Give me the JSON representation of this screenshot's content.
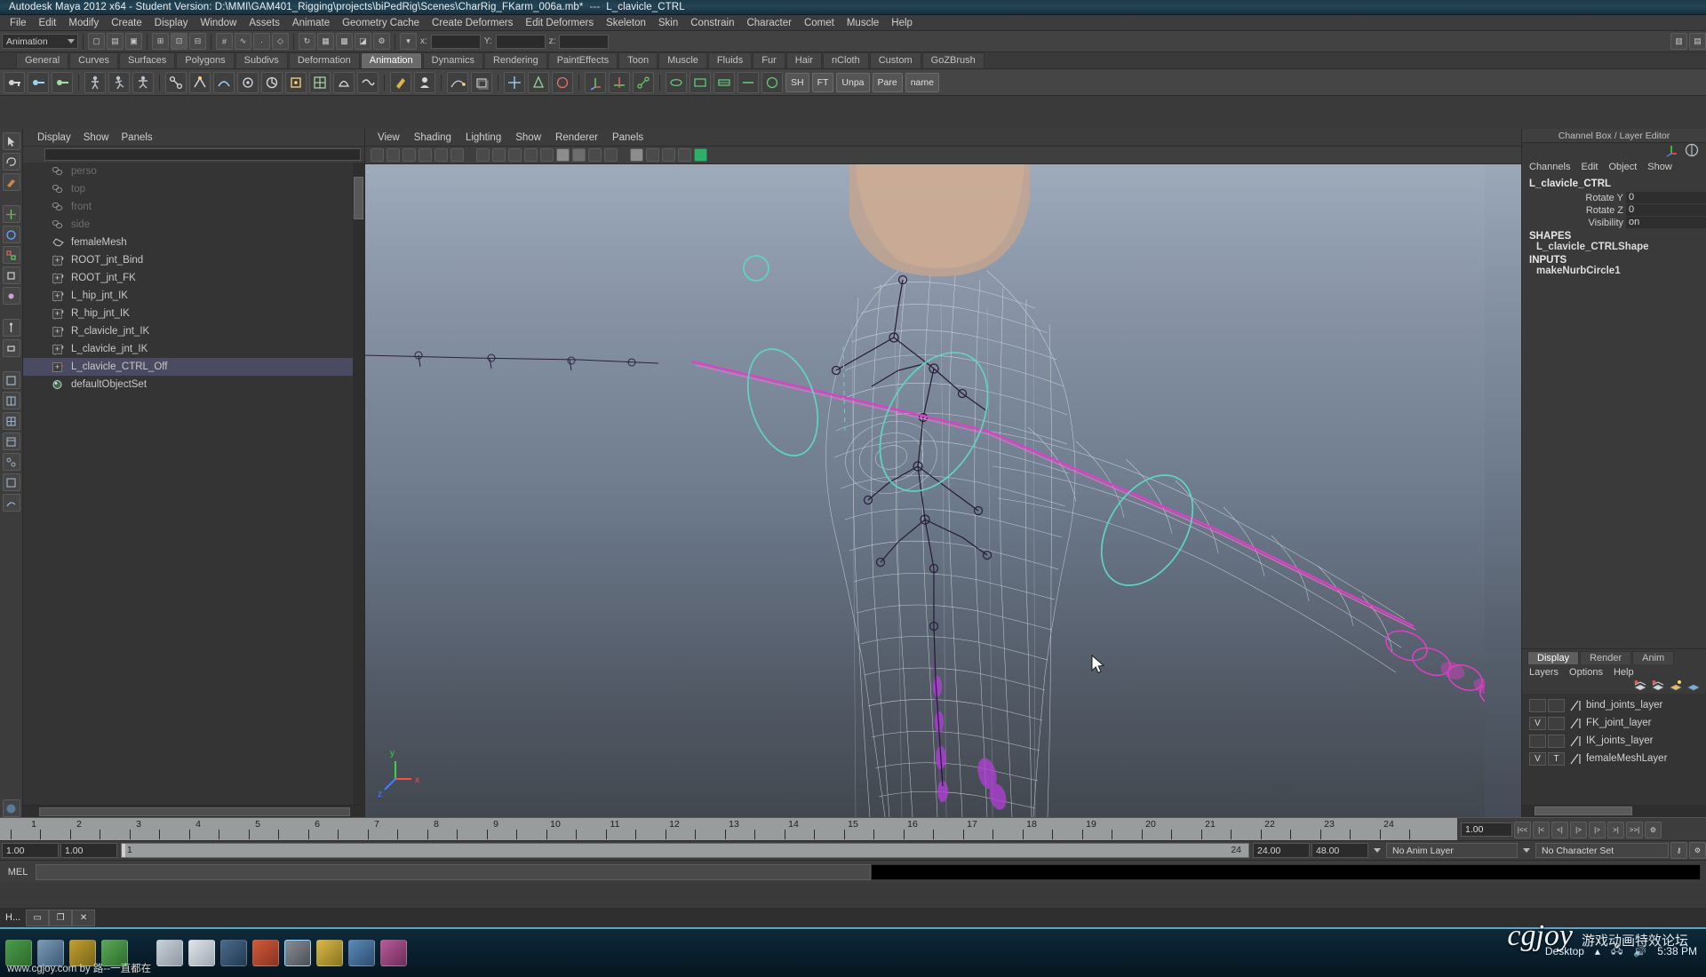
{
  "titlebar": {
    "app": "Autodesk Maya 2012 x64 - Student Version: D:\\MMI\\GAM401_Rigging\\projects\\biPedRig\\Scenes\\CharRig_FKarm_006a.mb*",
    "separator": "---",
    "selection": "L_clavicle_CTRL"
  },
  "menubar": {
    "items": [
      {
        "label": "File"
      },
      {
        "label": "Edit"
      },
      {
        "label": "Modify"
      },
      {
        "label": "Create"
      },
      {
        "label": "Display"
      },
      {
        "label": "Window"
      },
      {
        "label": "Assets"
      },
      {
        "label": "Animate"
      },
      {
        "label": "Geometry Cache"
      },
      {
        "label": "Create Deformers"
      },
      {
        "label": "Edit Deformers"
      },
      {
        "label": "Skeleton"
      },
      {
        "label": "Skin"
      },
      {
        "label": "Constrain"
      },
      {
        "label": "Character"
      },
      {
        "label": "Comet"
      },
      {
        "label": "Muscle"
      },
      {
        "label": "Help"
      }
    ]
  },
  "statusline": {
    "mode_selector": "Animation",
    "axis_labels": [
      "x:",
      "Y:",
      "z:"
    ],
    "axis_values": [
      "",
      "",
      ""
    ]
  },
  "shelf": {
    "tabs": [
      {
        "label": "General",
        "active": false
      },
      {
        "label": "Curves",
        "active": false
      },
      {
        "label": "Surfaces",
        "active": false
      },
      {
        "label": "Polygons",
        "active": false
      },
      {
        "label": "Subdivs",
        "active": false
      },
      {
        "label": "Deformation",
        "active": false
      },
      {
        "label": "Animation",
        "active": true
      },
      {
        "label": "Dynamics",
        "active": false
      },
      {
        "label": "Rendering",
        "active": false
      },
      {
        "label": "PaintEffects",
        "active": false
      },
      {
        "label": "Toon",
        "active": false
      },
      {
        "label": "Muscle",
        "active": false
      },
      {
        "label": "Fluids",
        "active": false
      },
      {
        "label": "Fur",
        "active": false
      },
      {
        "label": "Hair",
        "active": false
      },
      {
        "label": "nCloth",
        "active": false
      },
      {
        "label": "Custom",
        "active": false
      },
      {
        "label": "GoZBrush",
        "active": false
      }
    ],
    "text_buttons": [
      {
        "label": "SH"
      },
      {
        "label": "FT"
      },
      {
        "label": "Unpa"
      },
      {
        "label": "Pare"
      },
      {
        "label": "name"
      }
    ]
  },
  "outliner": {
    "menu": [
      "Display",
      "Show",
      "Panels"
    ],
    "search_value": "",
    "items": [
      {
        "label": "perso",
        "icon": "camera-icon",
        "dim": true,
        "expandable": false,
        "selected": false
      },
      {
        "label": "top",
        "icon": "camera-icon",
        "dim": true,
        "expandable": false,
        "selected": false
      },
      {
        "label": "front",
        "icon": "camera-icon",
        "dim": true,
        "expandable": false,
        "selected": false
      },
      {
        "label": "side",
        "icon": "camera-icon",
        "dim": true,
        "expandable": false,
        "selected": false
      },
      {
        "label": "femaleMesh",
        "icon": "mesh-icon",
        "dim": false,
        "expandable": false,
        "selected": false
      },
      {
        "label": "ROOT_jnt_Bind",
        "icon": "joint-icon",
        "dim": false,
        "expandable": true,
        "selected": false
      },
      {
        "label": "ROOT_jnt_FK",
        "icon": "joint-icon",
        "dim": false,
        "expandable": true,
        "selected": false
      },
      {
        "label": "L_hip_jnt_IK",
        "icon": "joint-icon",
        "dim": false,
        "expandable": true,
        "selected": false
      },
      {
        "label": "R_hip_jnt_IK",
        "icon": "joint-icon",
        "dim": false,
        "expandable": true,
        "selected": false
      },
      {
        "label": "R_clavicle_jnt_IK",
        "icon": "joint-icon",
        "dim": false,
        "expandable": true,
        "selected": false
      },
      {
        "label": "L_clavicle_jnt_IK",
        "icon": "joint-icon",
        "dim": false,
        "expandable": true,
        "selected": false
      },
      {
        "label": "L_clavicle_CTRL_Off",
        "icon": "curve-icon",
        "dim": false,
        "expandable": true,
        "selected": true
      },
      {
        "label": "defaultObjectSet",
        "icon": "set-icon",
        "dim": false,
        "expandable": false,
        "selected": false
      }
    ]
  },
  "viewport": {
    "menu": [
      "View",
      "Shading",
      "Lighting",
      "Show",
      "Renderer",
      "Panels"
    ],
    "axis": {
      "x": "x",
      "y": "y",
      "z": "z"
    },
    "corner_note": ""
  },
  "channelbox": {
    "panel_title": "Channel Box / Layer Editor",
    "menu": [
      "Channels",
      "Edit",
      "Object",
      "Show"
    ],
    "node_name": "L_clavicle_CTRL",
    "attributes": [
      {
        "name": "Rotate Y",
        "value": "0"
      },
      {
        "name": "Rotate Z",
        "value": "0"
      },
      {
        "name": "Visibility",
        "value": "on"
      }
    ],
    "shapes_header": "SHAPES",
    "shape_name": "L_clavicle_CTRLShape",
    "inputs_header": "INPUTS",
    "input_name": "makeNurbCircle1"
  },
  "layereditor": {
    "tabs": [
      {
        "label": "Display",
        "active": true
      },
      {
        "label": "Render",
        "active": false
      },
      {
        "label": "Anim",
        "active": false
      }
    ],
    "menu": [
      "Layers",
      "Options",
      "Help"
    ],
    "layers": [
      {
        "visibility": "",
        "type": "",
        "color": "#6d7d8e",
        "name": "bind_joints_layer"
      },
      {
        "visibility": "V",
        "type": "",
        "color": "#6d7d8e",
        "name": "FK_joint_layer"
      },
      {
        "visibility": "",
        "type": "",
        "color": "#6d7d8e",
        "name": "IK_joints_layer"
      },
      {
        "visibility": "V",
        "type": "T",
        "color": "#6d7d8e",
        "name": "femaleMeshLayer"
      }
    ]
  },
  "timeline": {
    "frames": [
      1,
      2,
      3,
      4,
      5,
      6,
      7,
      8,
      9,
      10,
      11,
      12,
      13,
      14,
      15,
      16,
      17,
      18,
      19,
      20,
      21,
      22,
      23,
      24
    ],
    "current_frame": "1.00",
    "playback_buttons": [
      "|<<",
      "|<",
      "<|",
      "|>",
      "|>",
      ">|",
      ">>|"
    ]
  },
  "rangebar": {
    "start_field": "1.00",
    "anim_start_field": "1.00",
    "range_left_label": "1",
    "range_right_label": "24",
    "range_end_field": "24.00",
    "anim_end_field": "48.00",
    "anim_layer": "No Anim Layer",
    "character_set": "No Character Set"
  },
  "melbar": {
    "label": "MEL",
    "input_value": "",
    "output_value": ""
  },
  "window_taskbar": {
    "window_label": "H...",
    "buttons": [
      "▭",
      "❐",
      "✕"
    ]
  },
  "desktop": {
    "desktop_label": "Desktop",
    "clock": "5:38 PM",
    "watermark": "cgjoy",
    "watermark_cn": "游戏动画特效论坛",
    "credit": "www.cgjoy.com  by 路--一直都在"
  },
  "colors": {
    "accent_cyan": "#5fd4c4",
    "accent_magenta": "#e13fc8",
    "mesh_wire": "#d8dde4",
    "selection_blue": "#4a4a63",
    "title_blue": "#244556"
  }
}
